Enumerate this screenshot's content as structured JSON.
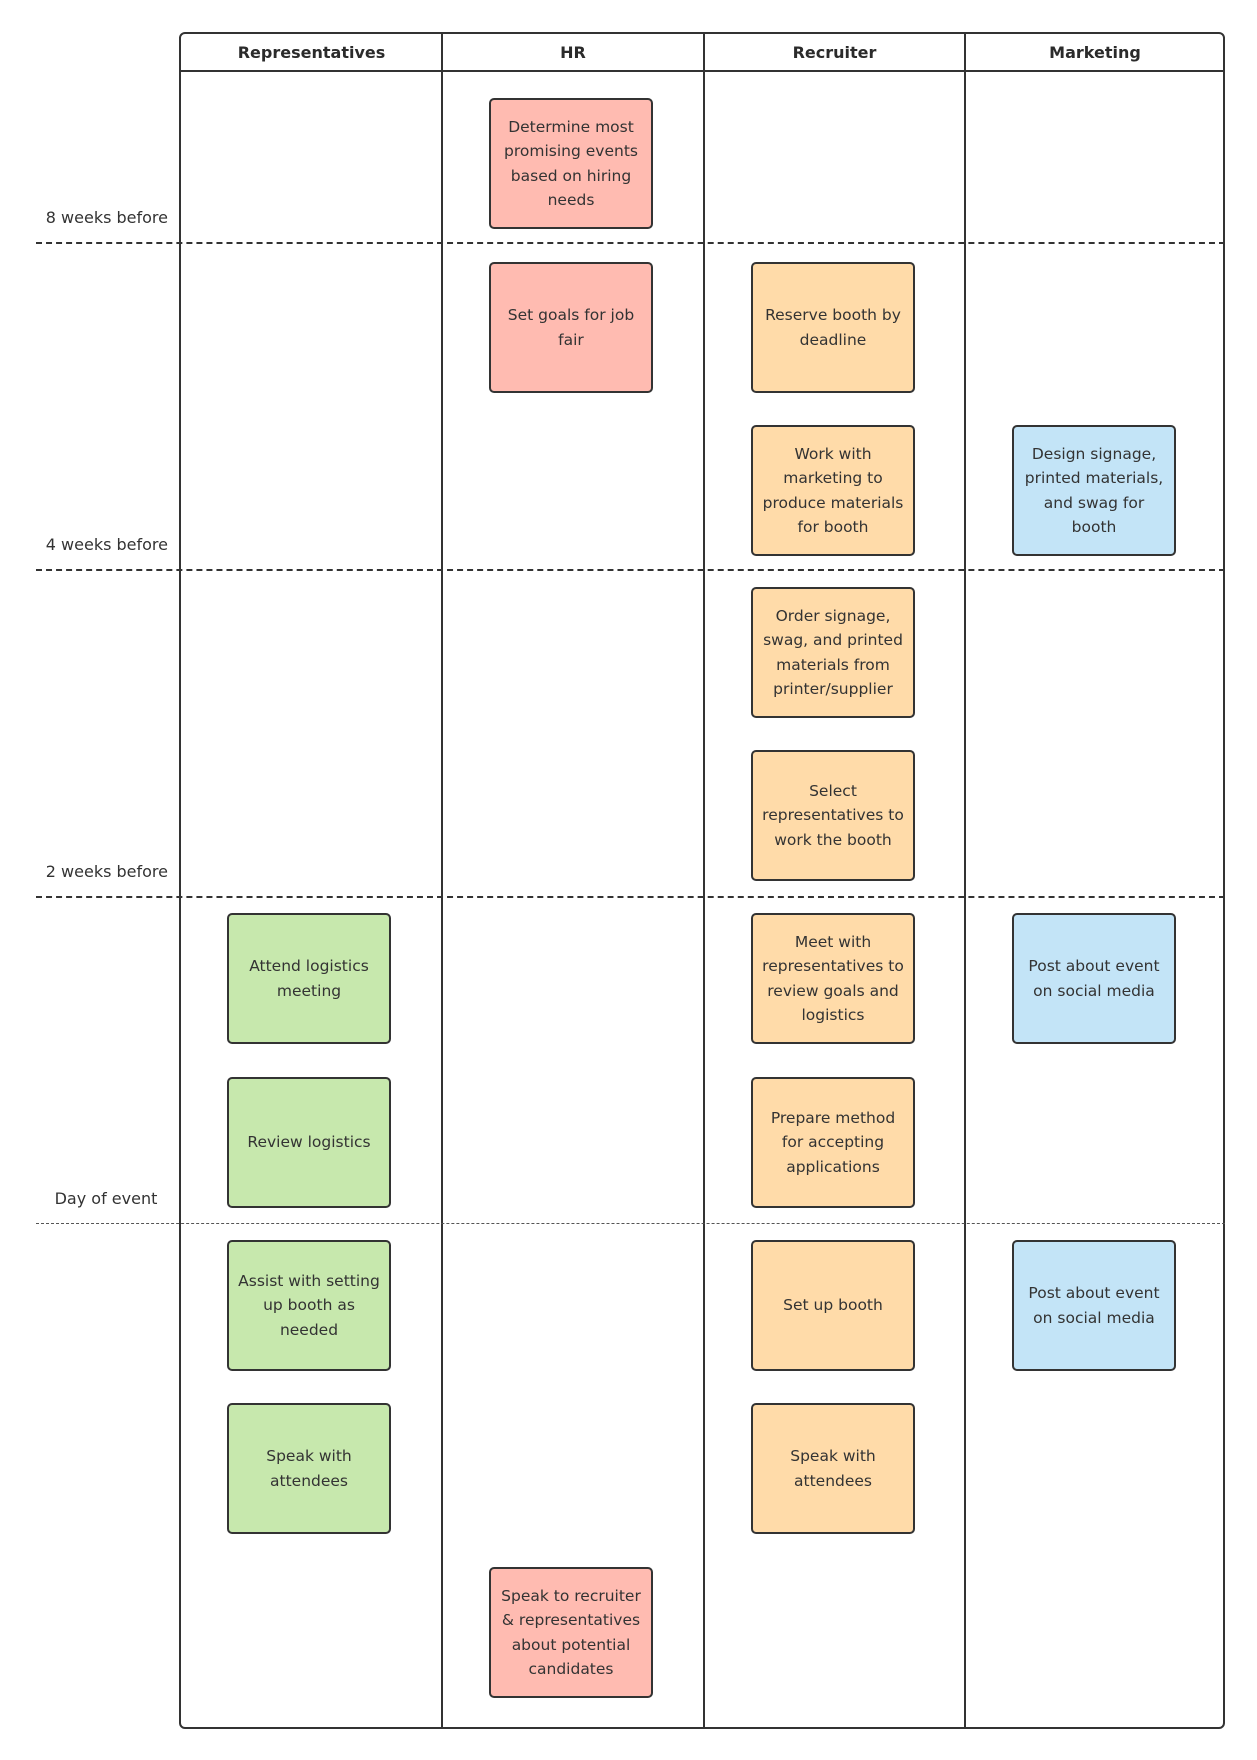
{
  "diagram": {
    "type": "swimlane",
    "lanes": [
      {
        "name": "Representatives"
      },
      {
        "name": "HR"
      },
      {
        "name": "Recruiter"
      },
      {
        "name": "Marketing"
      }
    ],
    "phases": [
      {
        "label": "8 weeks before",
        "style": "dashed"
      },
      {
        "label": "4 weeks before",
        "style": "dashed"
      },
      {
        "label": "2 weeks before",
        "style": "dashed"
      },
      {
        "label": "Day of event",
        "style": "dashed-light"
      }
    ],
    "colors": {
      "Representatives": "#c7e8ad",
      "HR": "#ffbbb1",
      "Recruiter": "#ffdba9",
      "Marketing": "#c3e4f7",
      "border": "#333333"
    },
    "cards": [
      {
        "lane": "HR",
        "row": 0,
        "text": "Determine most promising events based on hiring needs"
      },
      {
        "lane": "HR",
        "row": 1,
        "text": "Set goals for job fair"
      },
      {
        "lane": "Recruiter",
        "row": 1,
        "text": "Reserve booth by deadline"
      },
      {
        "lane": "Recruiter",
        "row": 2,
        "text": "Work with marketing to produce materials for booth"
      },
      {
        "lane": "Marketing",
        "row": 2,
        "text": "Design signage, printed materials, and swag for booth"
      },
      {
        "lane": "Recruiter",
        "row": 3,
        "text": "Order signage, swag, and printed materials from printer/supplier"
      },
      {
        "lane": "Recruiter",
        "row": 4,
        "text": "Select representatives to work the booth"
      },
      {
        "lane": "Representatives",
        "row": 5,
        "text": "Attend logistics meeting"
      },
      {
        "lane": "Recruiter",
        "row": 5,
        "text": "Meet with representatives to review goals and logistics"
      },
      {
        "lane": "Marketing",
        "row": 5,
        "text": "Post about event on social media"
      },
      {
        "lane": "Representatives",
        "row": 6,
        "text": "Review logistics"
      },
      {
        "lane": "Recruiter",
        "row": 6,
        "text": "Prepare method for accepting applications"
      },
      {
        "lane": "Representatives",
        "row": 7,
        "text": "Assist with setting up booth as needed"
      },
      {
        "lane": "Recruiter",
        "row": 7,
        "text": "Set up booth"
      },
      {
        "lane": "Marketing",
        "row": 7,
        "text": "Post about event on social media"
      },
      {
        "lane": "Representatives",
        "row": 8,
        "text": "Speak with attendees"
      },
      {
        "lane": "Recruiter",
        "row": 8,
        "text": "Speak with attendees"
      },
      {
        "lane": "HR",
        "row": 9,
        "text": "Speak to recruiter & representatives about potential candidates"
      }
    ]
  }
}
